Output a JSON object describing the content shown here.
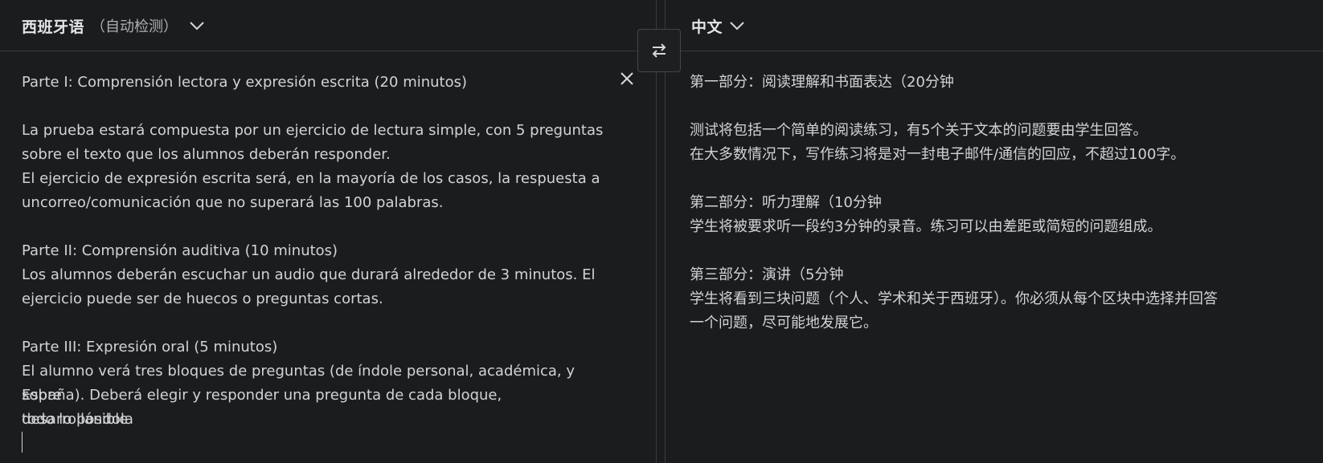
{
  "source": {
    "language": "西班牙语",
    "detect_label": "（自动检测）",
    "text_lines": [
      "Parte I: Comprensión lectora y expresión escrita (20 minutos)",
      "",
      "La prueba estará compuesta por un ejercicio de lectura simple, con 5 preguntas",
      "sobre el texto que los alumnos deberán responder.",
      "El ejercicio de expresión escrita será, en la mayoría de los casos, la respuesta a",
      "uncorreo/comunicación que no superará las 100 palabras.",
      "",
      "Parte II: Comprensión auditiva (10 minutos)",
      "Los alumnos deberán escuchar un audio que durará alrededor de 3 minutos. El",
      "ejercicio puede ser de huecos o preguntas cortas.",
      "",
      "Parte III: Expresión oral (5 minutos)",
      "El alumno verá tres bloques de preguntas (de índole personal, académica, y sobre",
      "España). Deberá elegir y responder una pregunta de cada bloque, desarrollándola",
      "todo lo posible"
    ]
  },
  "target": {
    "language": "中文",
    "text_lines": [
      "第一部分：阅读理解和书面表达（20分钟",
      "",
      "测试将包括一个简单的阅读练习，有5个关于文本的问题要由学生回答。",
      "在大多数情况下，写作练习将是对一封电子邮件/通信的回应，不超过100字。",
      "",
      "第二部分：听力理解（10分钟",
      "学生将被要求听一段约3分钟的录音。练习可以由差距或简短的问题组成。",
      "",
      "第三部分：演讲（5分钟",
      "学生将看到三块问题（个人、学术和关于西班牙）。你必须从每个区块中选择并回答",
      "一个问题，尽可能地发展它。"
    ]
  },
  "icons": {
    "swap": "swap-arrows-icon",
    "close": "close-icon",
    "dropdown": "chevron-down-icon"
  },
  "colors": {
    "background": "#1b1c1e",
    "text": "#d2d3d5",
    "border": "#3a3b3e"
  }
}
